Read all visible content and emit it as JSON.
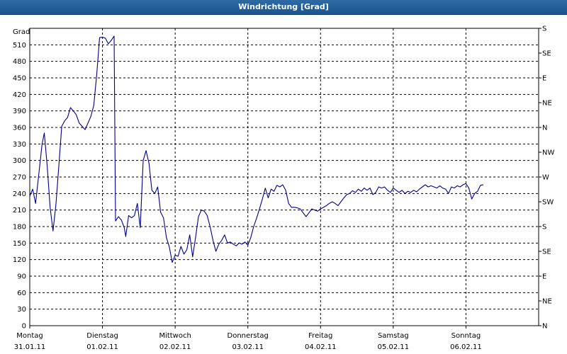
{
  "window": {
    "title": "Windrichtung [Grad]"
  },
  "chart_data": {
    "type": "line",
    "title": "Windrichtung [Grad]",
    "ylabel": "Grad",
    "ylim": [
      0,
      540
    ],
    "grid": true,
    "line_color": "#00008b",
    "grid_color": "#000000",
    "y_ticks": [
      0,
      30,
      60,
      90,
      120,
      150,
      180,
      210,
      240,
      270,
      300,
      330,
      360,
      390,
      420,
      450,
      480,
      510
    ],
    "y2_ticks": [
      {
        "value": 0,
        "label": "N"
      },
      {
        "value": 45,
        "label": "NE"
      },
      {
        "value": 90,
        "label": "E"
      },
      {
        "value": 135,
        "label": "SE"
      },
      {
        "value": 180,
        "label": "S"
      },
      {
        "value": 225,
        "label": "SW"
      },
      {
        "value": 270,
        "label": "W"
      },
      {
        "value": 315,
        "label": "NW"
      },
      {
        "value": 360,
        "label": "N"
      },
      {
        "value": 405,
        "label": "NE"
      },
      {
        "value": 450,
        "label": "E"
      },
      {
        "value": 495,
        "label": "SE"
      },
      {
        "value": 540,
        "label": "S"
      }
    ],
    "x_days": [
      {
        "day": "Montag",
        "date": "31.01.11"
      },
      {
        "day": "Dienstag",
        "date": "01.02.11"
      },
      {
        "day": "Mittwoch",
        "date": "02.02.11"
      },
      {
        "day": "Donnerstag",
        "date": "03.02.11"
      },
      {
        "day": "Freitag",
        "date": "04.02.11"
      },
      {
        "day": "Samstag",
        "date": "05.02.11"
      },
      {
        "day": "Sonntag",
        "date": "06.02.11"
      }
    ],
    "x_range_days": [
      0,
      7
    ],
    "points": [
      [
        0.0,
        235
      ],
      [
        0.04,
        248
      ],
      [
        0.08,
        222
      ],
      [
        0.12,
        270
      ],
      [
        0.17,
        330
      ],
      [
        0.2,
        350
      ],
      [
        0.24,
        290
      ],
      [
        0.28,
        215
      ],
      [
        0.32,
        172
      ],
      [
        0.36,
        220
      ],
      [
        0.4,
        290
      ],
      [
        0.44,
        362
      ],
      [
        0.48,
        372
      ],
      [
        0.52,
        378
      ],
      [
        0.56,
        396
      ],
      [
        0.6,
        390
      ],
      [
        0.64,
        383
      ],
      [
        0.68,
        368
      ],
      [
        0.72,
        362
      ],
      [
        0.76,
        356
      ],
      [
        0.8,
        368
      ],
      [
        0.84,
        380
      ],
      [
        0.88,
        400
      ],
      [
        0.92,
        455
      ],
      [
        0.96,
        523
      ],
      [
        1.0,
        524
      ],
      [
        1.04,
        522
      ],
      [
        1.08,
        512
      ],
      [
        1.12,
        518
      ],
      [
        1.16,
        526
      ],
      [
        1.18,
        190
      ],
      [
        1.22,
        198
      ],
      [
        1.26,
        192
      ],
      [
        1.3,
        178
      ],
      [
        1.32,
        162
      ],
      [
        1.36,
        200
      ],
      [
        1.4,
        196
      ],
      [
        1.44,
        200
      ],
      [
        1.48,
        222
      ],
      [
        1.52,
        178
      ],
      [
        1.56,
        300
      ],
      [
        1.6,
        318
      ],
      [
        1.64,
        295
      ],
      [
        1.68,
        246
      ],
      [
        1.72,
        240
      ],
      [
        1.76,
        252
      ],
      [
        1.8,
        206
      ],
      [
        1.84,
        196
      ],
      [
        1.88,
        160
      ],
      [
        1.92,
        143
      ],
      [
        1.96,
        115
      ],
      [
        2.0,
        128
      ],
      [
        2.04,
        126
      ],
      [
        2.08,
        144
      ],
      [
        2.12,
        130
      ],
      [
        2.16,
        138
      ],
      [
        2.2,
        165
      ],
      [
        2.24,
        125
      ],
      [
        2.28,
        160
      ],
      [
        2.32,
        198
      ],
      [
        2.36,
        210
      ],
      [
        2.4,
        208
      ],
      [
        2.44,
        200
      ],
      [
        2.48,
        180
      ],
      [
        2.52,
        155
      ],
      [
        2.56,
        135
      ],
      [
        2.6,
        148
      ],
      [
        2.64,
        155
      ],
      [
        2.68,
        165
      ],
      [
        2.72,
        150
      ],
      [
        2.76,
        152
      ],
      [
        2.8,
        148
      ],
      [
        2.84,
        145
      ],
      [
        2.88,
        150
      ],
      [
        2.92,
        148
      ],
      [
        2.96,
        152
      ],
      [
        3.0,
        146
      ],
      [
        3.04,
        160
      ],
      [
        3.08,
        180
      ],
      [
        3.12,
        195
      ],
      [
        3.16,
        212
      ],
      [
        3.2,
        230
      ],
      [
        3.24,
        250
      ],
      [
        3.28,
        232
      ],
      [
        3.32,
        248
      ],
      [
        3.36,
        244
      ],
      [
        3.4,
        255
      ],
      [
        3.44,
        252
      ],
      [
        3.48,
        256
      ],
      [
        3.52,
        246
      ],
      [
        3.56,
        222
      ],
      [
        3.6,
        215
      ],
      [
        3.64,
        215
      ],
      [
        3.68,
        214
      ],
      [
        3.72,
        212
      ],
      [
        3.76,
        205
      ],
      [
        3.8,
        198
      ],
      [
        3.84,
        205
      ],
      [
        3.88,
        212
      ],
      [
        3.92,
        210
      ],
      [
        3.96,
        208
      ],
      [
        4.0,
        212
      ],
      [
        4.04,
        215
      ],
      [
        4.08,
        218
      ],
      [
        4.12,
        222
      ],
      [
        4.16,
        225
      ],
      [
        4.2,
        222
      ],
      [
        4.24,
        218
      ],
      [
        4.28,
        225
      ],
      [
        4.32,
        232
      ],
      [
        4.36,
        238
      ],
      [
        4.4,
        240
      ],
      [
        4.44,
        245
      ],
      [
        4.48,
        242
      ],
      [
        4.52,
        248
      ],
      [
        4.56,
        244
      ],
      [
        4.6,
        250
      ],
      [
        4.64,
        246
      ],
      [
        4.68,
        250
      ],
      [
        4.72,
        238
      ],
      [
        4.76,
        242
      ],
      [
        4.8,
        252
      ],
      [
        4.84,
        250
      ],
      [
        4.88,
        252
      ],
      [
        4.92,
        246
      ],
      [
        4.96,
        242
      ],
      [
        5.0,
        250
      ],
      [
        5.04,
        246
      ],
      [
        5.08,
        242
      ],
      [
        5.12,
        246
      ],
      [
        5.16,
        240
      ],
      [
        5.2,
        244
      ],
      [
        5.24,
        242
      ],
      [
        5.28,
        246
      ],
      [
        5.32,
        243
      ],
      [
        5.36,
        248
      ],
      [
        5.4,
        252
      ],
      [
        5.44,
        256
      ],
      [
        5.48,
        252
      ],
      [
        5.52,
        254
      ],
      [
        5.56,
        252
      ],
      [
        5.6,
        250
      ],
      [
        5.64,
        254
      ],
      [
        5.68,
        250
      ],
      [
        5.72,
        248
      ],
      [
        5.76,
        240
      ],
      [
        5.8,
        252
      ],
      [
        5.84,
        250
      ],
      [
        5.88,
        254
      ],
      [
        5.92,
        252
      ],
      [
        5.96,
        256
      ],
      [
        6.0,
        258
      ],
      [
        6.04,
        250
      ],
      [
        6.08,
        230
      ],
      [
        6.12,
        240
      ],
      [
        6.16,
        244
      ],
      [
        6.2,
        255
      ],
      [
        6.24,
        256
      ]
    ]
  }
}
